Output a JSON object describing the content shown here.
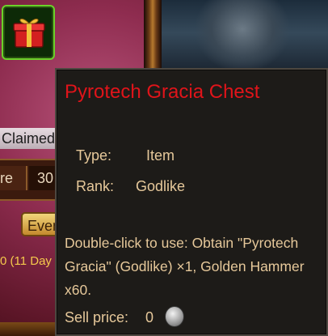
{
  "left_panel": {
    "claimed_label": "Claimed",
    "tab_left_text": "re",
    "tab_right_text": "30",
    "event_button_text": "Even",
    "days_text": "0 (11 Day"
  },
  "tooltip": {
    "title": "Pyrotech Gracia Chest",
    "type_label": "Type:",
    "type_value": "Item",
    "rank_label": "Rank:",
    "rank_value": "Godlike",
    "description": "Double-click to use: Obtain \"Pyrotech Gracia\" (Godlike) ×1, Golden Hammer x60.",
    "sell_label": "Sell price:",
    "sell_value": "0",
    "colors": {
      "title": "#e0141a",
      "text": "#e6c89a",
      "background": "#1d1b18"
    }
  },
  "icons": {
    "chest_icon": "red gift box with gold ribbon",
    "currency_icon": "silver coin"
  }
}
